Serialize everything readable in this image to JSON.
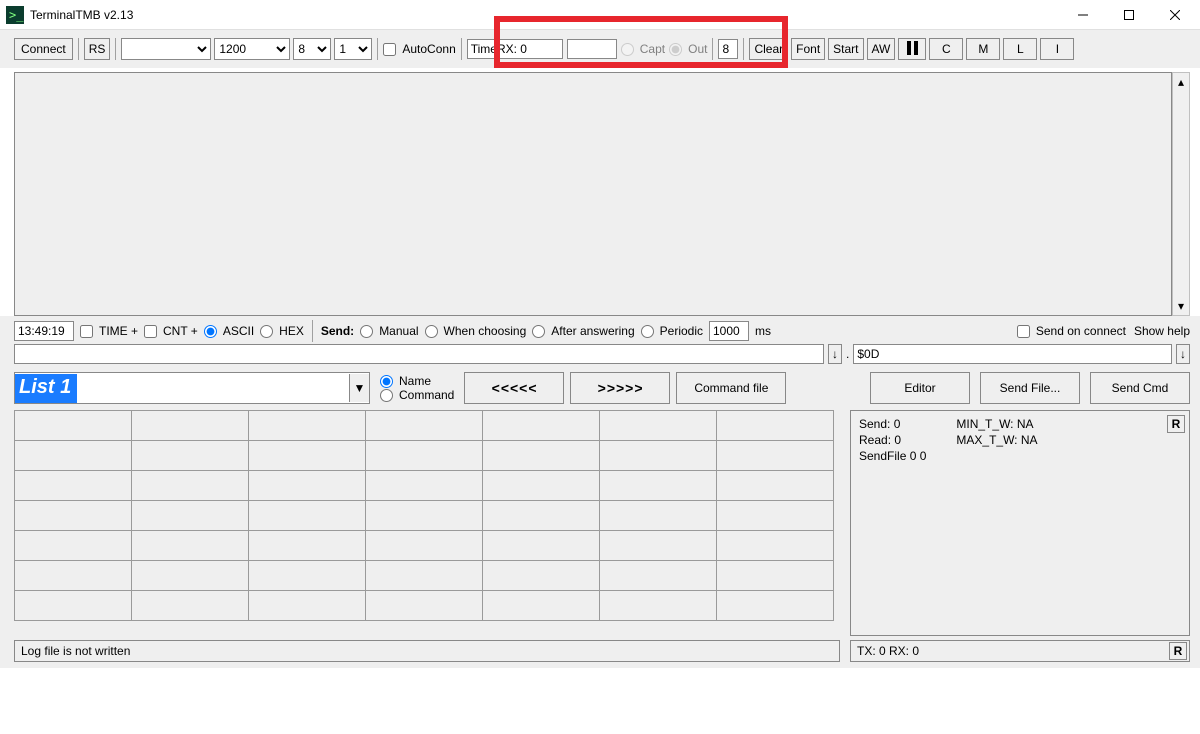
{
  "window": {
    "title": "TerminalTMB v2.13"
  },
  "toolbar": {
    "connect": "Connect",
    "rs": "RS",
    "port_value": "",
    "baud_value": "1200",
    "databits_value": "8",
    "stopbits_value": "1",
    "autoconn": "AutoConn",
    "time_rx_label": "TimeRX: 0",
    "time_rx_value": "",
    "capt": "Capt",
    "out": "Out",
    "out_value": "8",
    "clear": "Clear",
    "font": "Font",
    "start": "Start",
    "aw": "AW",
    "c": "C",
    "m": "M",
    "l": "L",
    "i": "I"
  },
  "options": {
    "time_value": "13:49:19",
    "time_plus": "TIME +",
    "cnt_plus": "CNT +",
    "ascii": "ASCII",
    "hex": "HEX",
    "send_label": "Send:",
    "manual": "Manual",
    "when_choosing": "When choosing",
    "after_answering": "After answering",
    "periodic": "Periodic",
    "period_value": "1000",
    "period_unit": "ms",
    "send_on_connect": "Send on connect",
    "show_help": "Show help"
  },
  "cmd": {
    "input_value": "",
    "terminator_value": "$0D"
  },
  "list": {
    "label": "List 1",
    "name_radio": "Name",
    "command_radio": "Command",
    "prev": "<<<<<",
    "next": ">>>>>",
    "command_file": "Command file",
    "editor": "Editor",
    "send_file": "Send File...",
    "send_cmd": "Send Cmd"
  },
  "stats": {
    "send": "Send: 0",
    "read": "Read: 0",
    "sendfile": "SendFile 0 0",
    "min_tw": "MIN_T_W:  NA",
    "max_tw": "MAX_T_W: NA",
    "r_btn": "R"
  },
  "status": {
    "log": "Log file is not written",
    "txrx": "TX: 0 RX: 0",
    "r_btn": "R"
  }
}
